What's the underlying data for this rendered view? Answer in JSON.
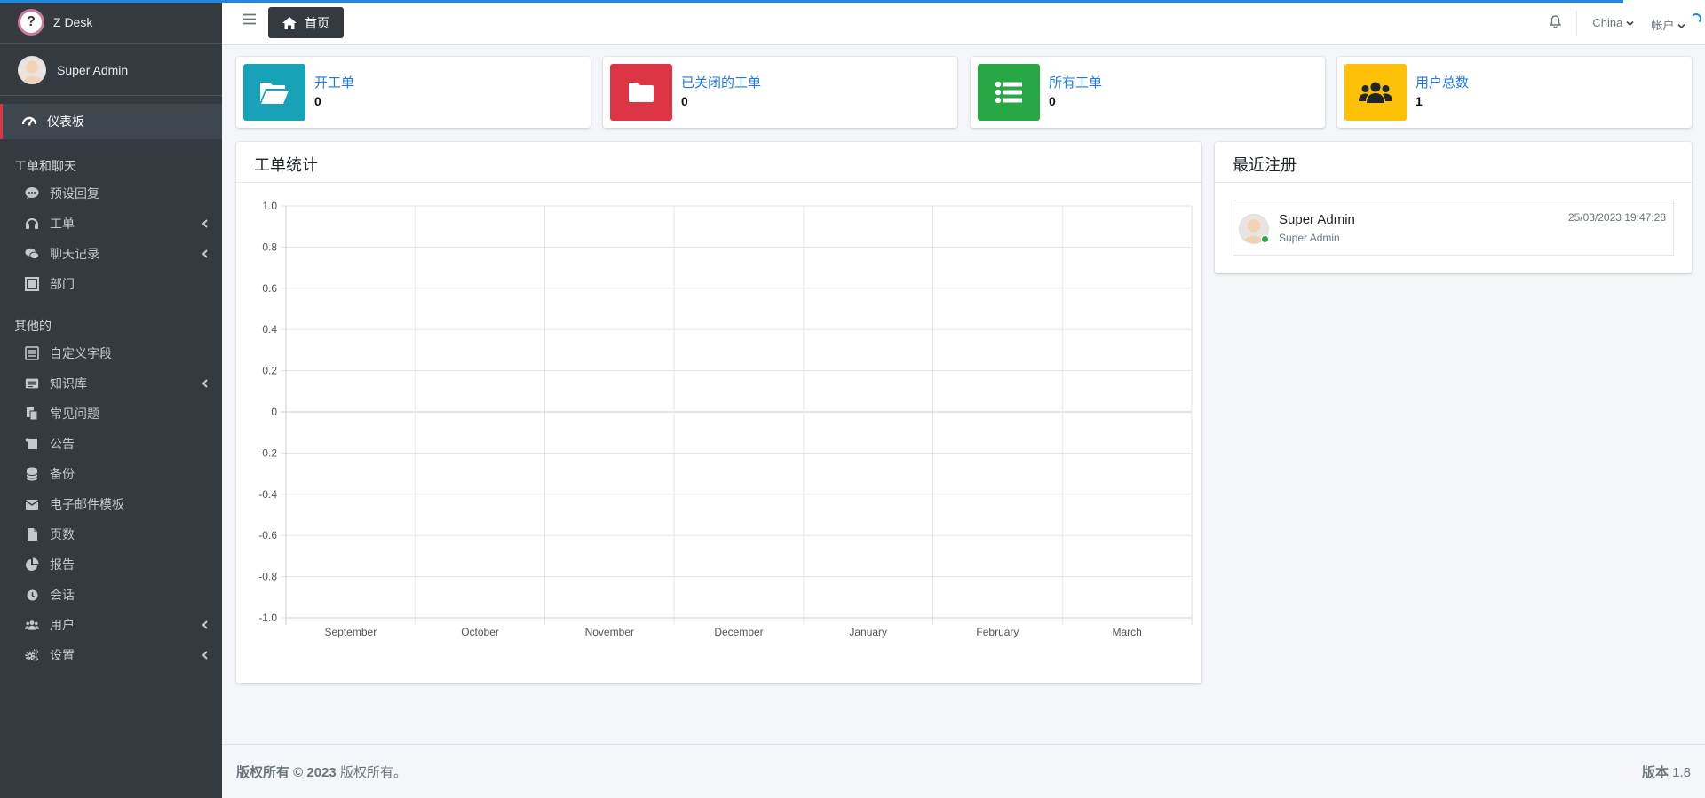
{
  "app": {
    "brand": "Z Desk",
    "user": "Super Admin"
  },
  "sidebar": {
    "active": "仪表板",
    "section1": "工单和聊天",
    "section1_items": [
      "预设回复",
      "工单",
      "聊天记录",
      "部门"
    ],
    "section2": "其他的",
    "section2_items": [
      "自定义字段",
      "知识库",
      "常见问题",
      "公告",
      "备份",
      "电子邮件模板",
      "页数",
      "报告",
      "会话",
      "用户",
      "设置"
    ]
  },
  "navbar": {
    "home": "首页",
    "language": "China",
    "account": "帐户"
  },
  "stats": [
    {
      "label": "开工单",
      "value": "0",
      "color": "#17a2b8",
      "icon": "folder-open-icon"
    },
    {
      "label": "已关闭的工单",
      "value": "0",
      "color": "#dc3545",
      "icon": "folder-icon"
    },
    {
      "label": "所有工单",
      "value": "0",
      "color": "#28a745",
      "icon": "list-icon"
    },
    {
      "label": "用户总数",
      "value": "1",
      "color": "#ffc107",
      "icon": "users-icon"
    }
  ],
  "ticket_stats": {
    "title": "工单统计"
  },
  "chart_data": {
    "type": "line",
    "title": "工单统计",
    "categories": [
      "September",
      "October",
      "November",
      "December",
      "January",
      "February",
      "March"
    ],
    "series": [],
    "ylim": [
      -1.0,
      1.0
    ],
    "yticks": [
      "1.0",
      "0.8",
      "0.6",
      "0.4",
      "0.2",
      "0",
      "-0.2",
      "-0.4",
      "-0.6",
      "-0.8",
      "-1.0"
    ],
    "grid": true
  },
  "recent": {
    "title": "最近注册",
    "items": [
      {
        "name": "Super Admin",
        "role": "Super Admin",
        "date": "25/03/2023 19:47:28"
      }
    ]
  },
  "footer": {
    "copyright_bold": "版权所有 © 2023",
    "copyright_rest": "版权所有。",
    "version_label": "版本",
    "version": "1.8"
  }
}
